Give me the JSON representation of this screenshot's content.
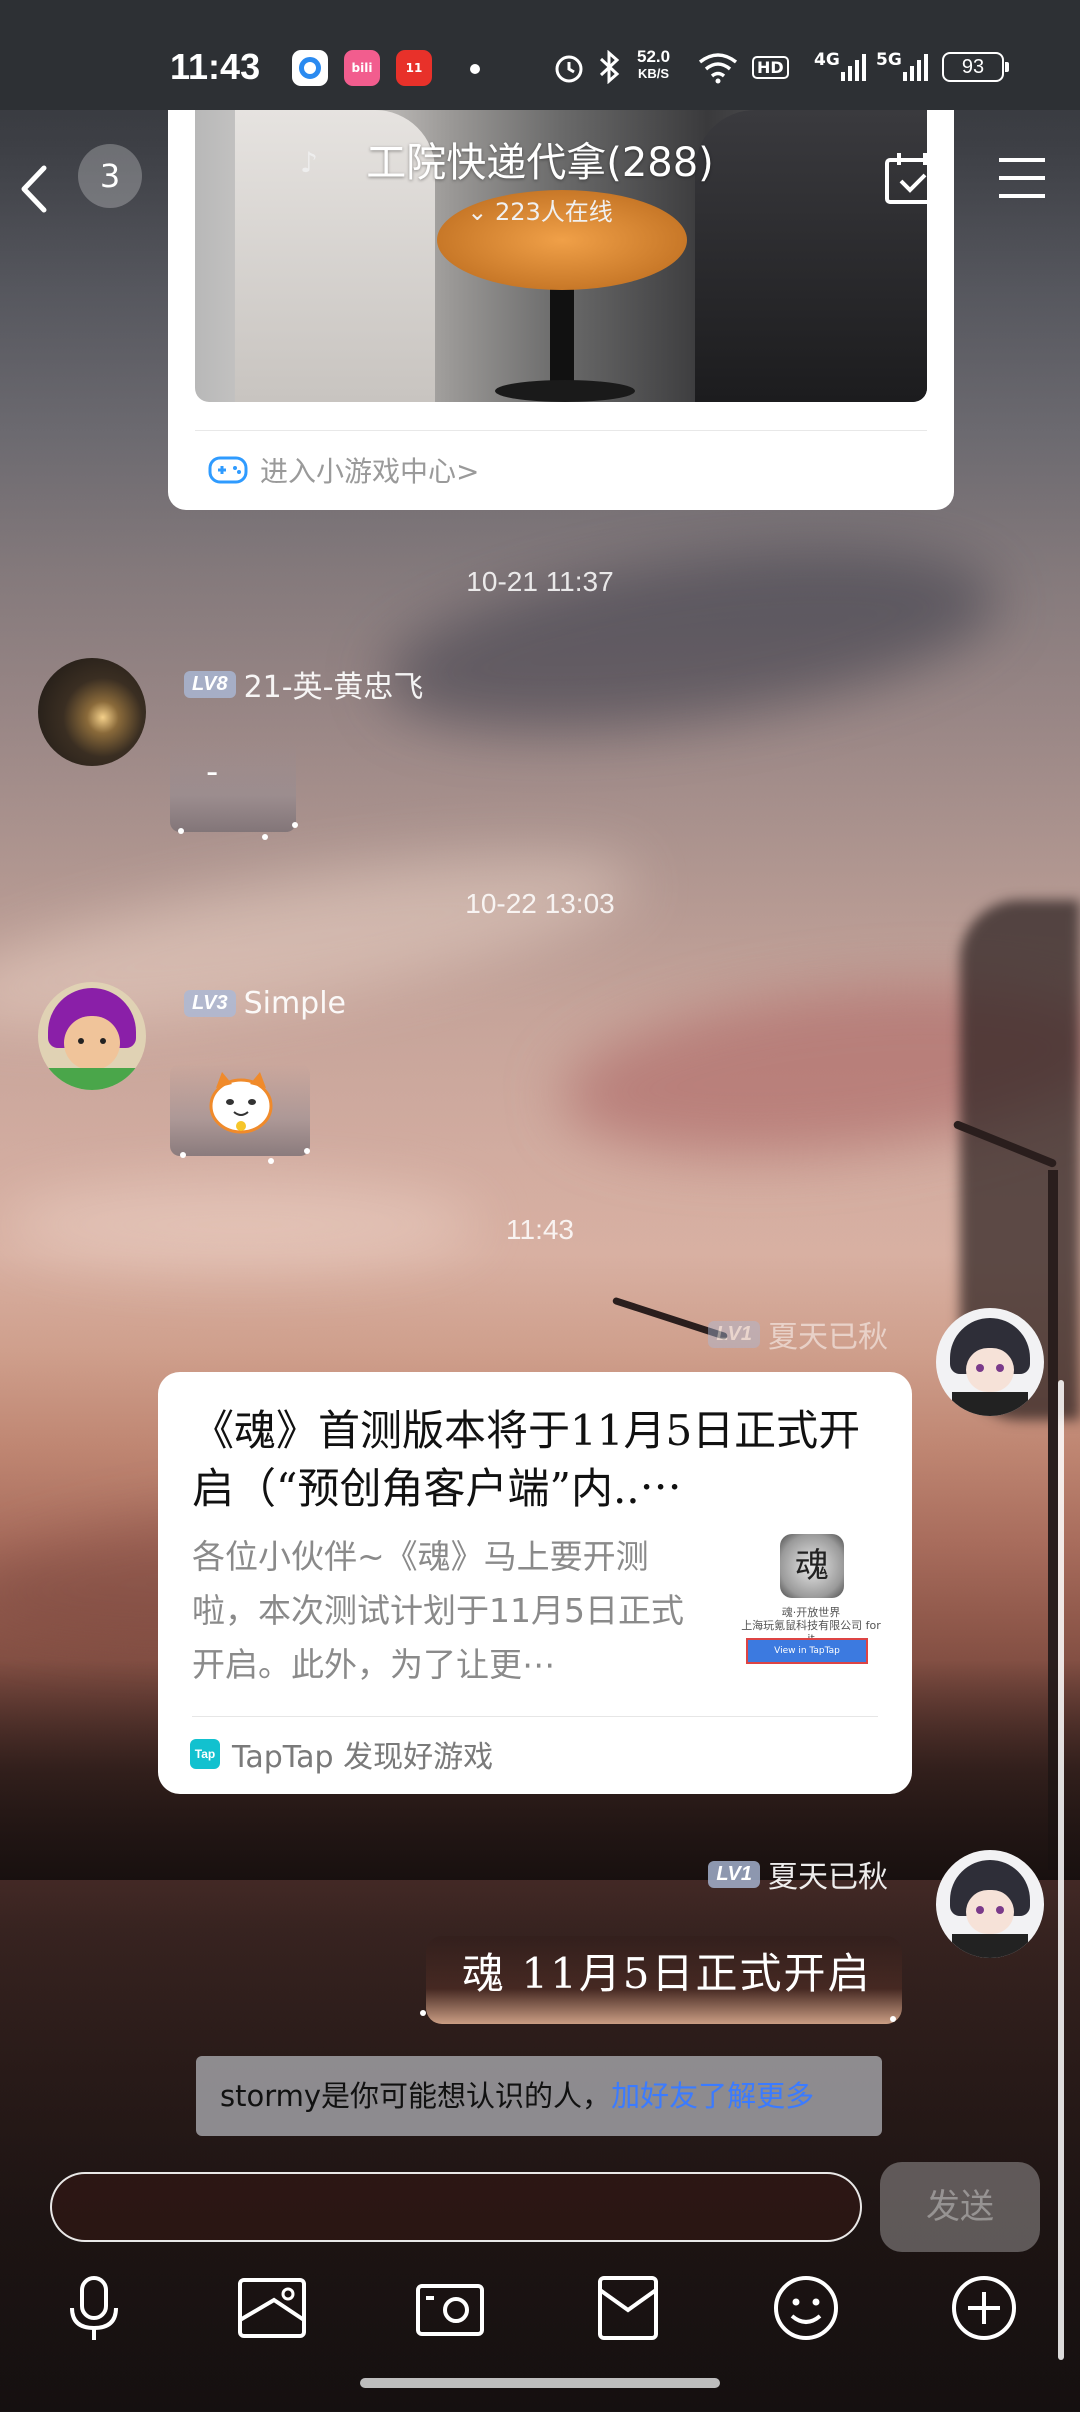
{
  "status_bar": {
    "time": "11:43",
    "net_speed_value": "52.0",
    "net_speed_unit": "KB/S",
    "hd_label": "HD",
    "signal_1": "4G",
    "signal_2": "5G",
    "battery": "93"
  },
  "header": {
    "unread_count": "3",
    "group_title": "工院快递代拿(288)",
    "online_count": "223人在线"
  },
  "game_card": {
    "link_text": "进入小游戏中心>"
  },
  "messages": {
    "ts1": "10-21 11:37",
    "msg1": {
      "level": "LV8",
      "sender": "21-英-黄忠飞",
      "text": "-"
    },
    "ts2": "10-22 13:03",
    "msg2": {
      "level": "LV3",
      "sender": "Simple"
    },
    "ts3": "11:43",
    "msg3": {
      "level": "LV1",
      "sender": "夏天已秋"
    },
    "msg4": {
      "level": "LV1",
      "sender": "夏天已秋",
      "text": "魂 11月5日正式开启"
    }
  },
  "tap_card": {
    "title": "《魂》首测版本将于11月5日正式开启（“预创角客户端”内..⋯",
    "description": "各位小伙伴~《魂》马上要开测啦，本次测试计划于11月5日正式开启。此外，为了让更⋯",
    "thumb_logo": "魂",
    "thumb_caption": "魂·开放世界",
    "thumb_company": "上海玩氪鼠科技有限公司 for it",
    "thumb_button": "View in TapTap",
    "source_logo": "Tap",
    "source": "TapTap 发现好游戏"
  },
  "suggestion": {
    "text": "stormy是你可能想认识的人，",
    "link": "加好友了解更多"
  },
  "input": {
    "send_label": "发送"
  },
  "colors": {
    "tap_brand": "#12c1cf",
    "link_blue": "#3b7bff",
    "level_badge": "#aab9d7"
  }
}
